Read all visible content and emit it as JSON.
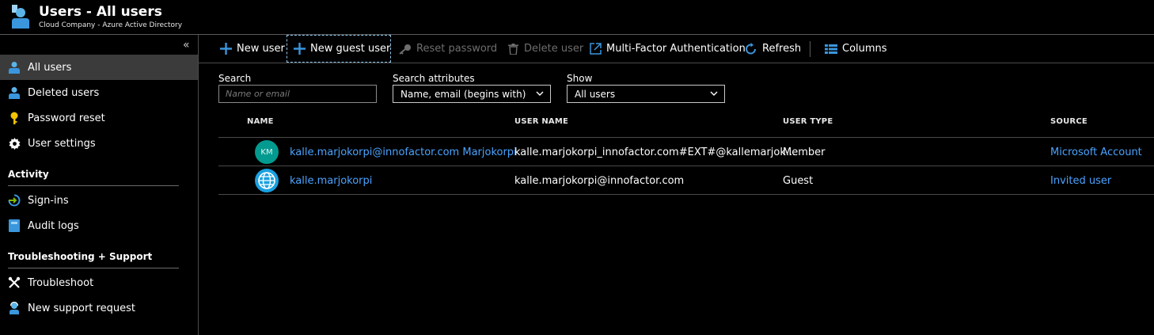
{
  "header": {
    "title": "Users - All users",
    "subtitle": "Cloud Company - Azure Active Directory"
  },
  "sidebar": {
    "collapse_glyph": "«",
    "items": [
      {
        "label": "All users",
        "icon": "user-icon",
        "active": true
      },
      {
        "label": "Deleted users",
        "icon": "user-icon"
      },
      {
        "label": "Password reset",
        "icon": "key-icon"
      },
      {
        "label": "User settings",
        "icon": "gear-icon"
      }
    ],
    "sections": [
      {
        "title": "Activity",
        "items": [
          {
            "label": "Sign-ins",
            "icon": "sign-in-icon"
          },
          {
            "label": "Audit logs",
            "icon": "audit-log-icon"
          }
        ]
      },
      {
        "title": "Troubleshooting + Support",
        "items": [
          {
            "label": "Troubleshoot",
            "icon": "wrench-icon"
          },
          {
            "label": "New support request",
            "icon": "support-person-icon"
          }
        ]
      }
    ]
  },
  "toolbar": {
    "new_user": "New user",
    "new_guest_user": "New guest user",
    "reset_password": "Reset password",
    "delete_user": "Delete user",
    "mfa": "Multi-Factor Authentication",
    "refresh": "Refresh",
    "columns": "Columns"
  },
  "filters": {
    "search_label": "Search",
    "search_placeholder": "Name or email",
    "search_value": "",
    "attributes_label": "Search attributes",
    "attributes_value": "Name, email (begins with)",
    "show_label": "Show",
    "show_value": "All users"
  },
  "table": {
    "headers": {
      "name": "NAME",
      "user_name": "USER NAME",
      "user_type": "USER TYPE",
      "source": "SOURCE"
    },
    "rows": [
      {
        "avatar_initials": "KM",
        "name": "kalle.marjokorpi@innofactor.com Marjokorpi",
        "user_name": "kalle.marjokorpi_innofactor.com#EXT#@kallemarjok...",
        "user_type": "Member",
        "source": "Microsoft Account"
      },
      {
        "avatar_icon": "globe-icon",
        "name": "kalle.marjokorpi",
        "user_name": "kalle.marjokorpi@innofactor.com",
        "user_type": "Guest",
        "source": "Invited user"
      }
    ]
  },
  "colors": {
    "accent_blue": "#4aa3ff",
    "icon_blue": "#3a96dd",
    "avatar_teal": "#039a8f",
    "active_bg": "#3b3b3b",
    "key_yellow": "#f3c300"
  }
}
